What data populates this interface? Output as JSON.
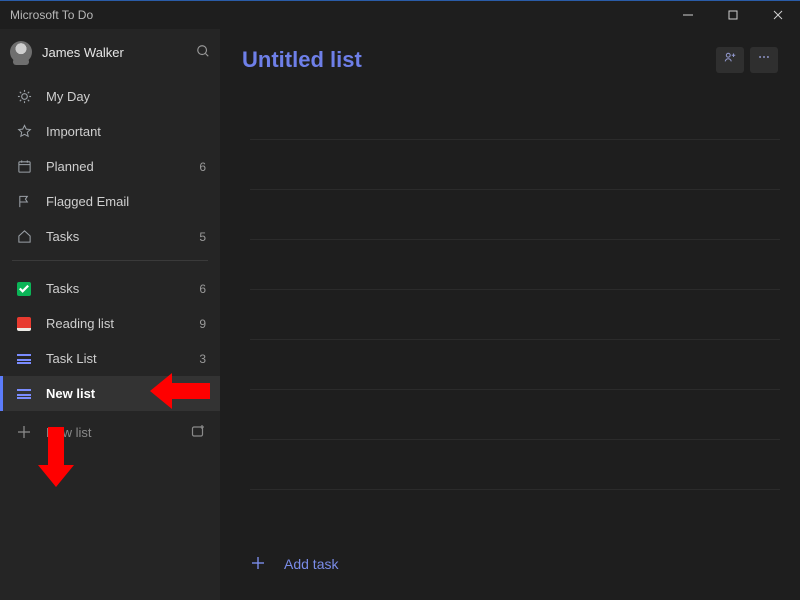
{
  "window": {
    "title": "Microsoft To Do"
  },
  "profile": {
    "name": "James Walker"
  },
  "sidebar": {
    "smart": [
      {
        "label": "My Day",
        "count": ""
      },
      {
        "label": "Important",
        "count": ""
      },
      {
        "label": "Planned",
        "count": "6"
      },
      {
        "label": "Flagged Email",
        "count": ""
      },
      {
        "label": "Tasks",
        "count": "5"
      }
    ],
    "lists": [
      {
        "label": "Tasks",
        "count": "6"
      },
      {
        "label": "Reading list",
        "count": "9"
      },
      {
        "label": "Task List",
        "count": "3"
      },
      {
        "label": "New list",
        "count": "",
        "selected": true
      }
    ],
    "new_list_label": "New list"
  },
  "main": {
    "title": "Untitled list",
    "add_task_label": "Add task"
  },
  "icons": {
    "minimize": "minimize-icon",
    "maximize": "maximize-icon",
    "close": "close-icon",
    "search": "search-icon",
    "sun": "sun-icon",
    "star": "star-icon",
    "calendar": "calendar-icon",
    "flag": "flag-icon",
    "home": "home-icon",
    "check_square": "check-square-icon",
    "book": "book-icon",
    "list": "list-icon",
    "plus": "plus-icon",
    "group": "new-group-icon",
    "share": "share-icon",
    "more": "more-icon"
  },
  "colors": {
    "accent": "#6e7fe8",
    "sidebar_bg": "#252525",
    "main_bg": "#1e1e1e",
    "annotation": "#ff0000"
  }
}
